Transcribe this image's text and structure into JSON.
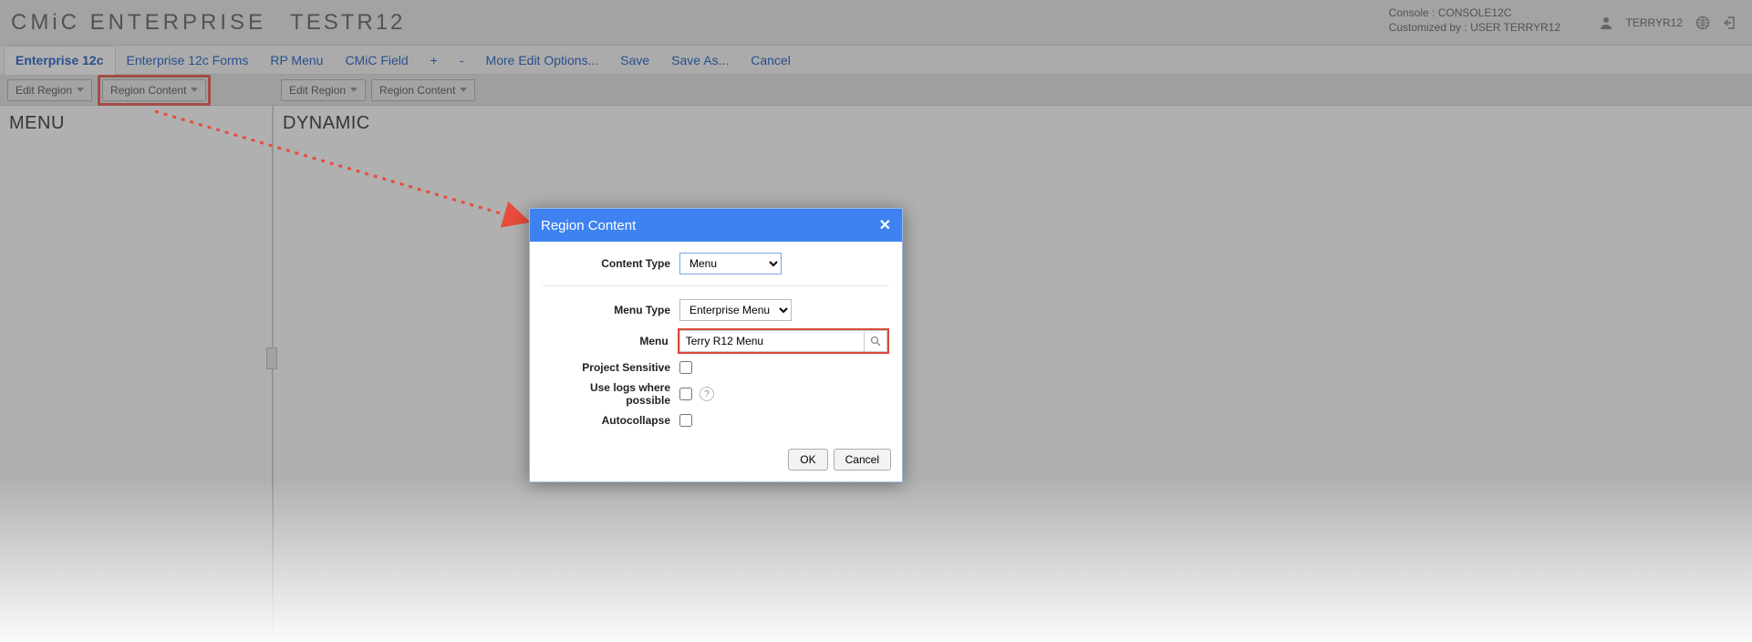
{
  "header": {
    "brand": "CMiC ENTERPRISE",
    "env": "TESTR12",
    "console_label": "Console :",
    "console_value": "CONSOLE12C",
    "customized_label": "Customized by :",
    "customized_value": "USER TERRYR12",
    "username": "TERRYR12"
  },
  "tabs": {
    "active": "Enterprise 12c",
    "items": [
      "Enterprise 12c",
      "Enterprise 12c Forms",
      "RP Menu",
      "CMiC Field",
      "+",
      "-",
      "More Edit Options...",
      "Save",
      "Save As...",
      "Cancel"
    ]
  },
  "toolbar": {
    "edit_region": "Edit Region",
    "region_content": "Region Content"
  },
  "panes": {
    "left_title": "MENU",
    "right_title": "DYNAMIC"
  },
  "dialog": {
    "title": "Region Content",
    "content_type_label": "Content Type",
    "content_type_value": "Menu",
    "menu_type_label": "Menu Type",
    "menu_type_value": "Enterprise Menu",
    "menu_label": "Menu",
    "menu_value": "Terry R12 Menu",
    "project_sensitive_label": "Project Sensitive",
    "use_logs_label": "Use logs where possible",
    "autocollapse_label": "Autocollapse",
    "ok": "OK",
    "cancel": "Cancel"
  }
}
